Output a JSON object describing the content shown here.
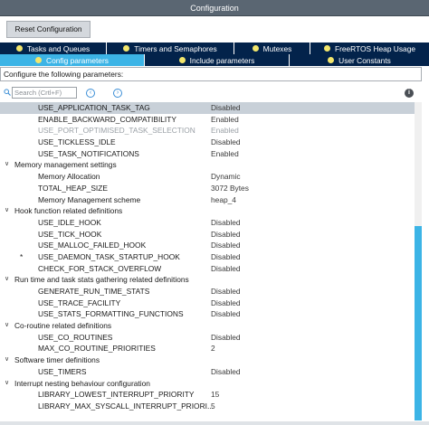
{
  "window": {
    "title": "Configuration"
  },
  "reset_button": "Reset Configuration",
  "tabs_row1": [
    {
      "label": "Tasks and Queues"
    },
    {
      "label": "Timers and Semaphores"
    },
    {
      "label": "Mutexes"
    },
    {
      "label": "FreeRTOS Heap Usage"
    }
  ],
  "tabs_row2": [
    {
      "label": "Config parameters",
      "active": true
    },
    {
      "label": "Include parameters"
    },
    {
      "label": "User Constants"
    }
  ],
  "configure_label": "Configure the following parameters:",
  "search": {
    "placeholder": "Search (Crtl+F)",
    "prev": "‹",
    "next": "›"
  },
  "info_icon": "i",
  "params": [
    {
      "name": "USE_APPLICATION_TASK_TAG",
      "value": "Disabled",
      "selected": true
    },
    {
      "name": "ENABLE_BACKWARD_COMPATIBILITY",
      "value": "Enabled"
    },
    {
      "name": "USE_PORT_OPTIMISED_TASK_SELECTION",
      "value": "Enabled",
      "disabled": true
    },
    {
      "name": "USE_TICKLESS_IDLE",
      "value": "Disabled"
    },
    {
      "name": "USE_TASK_NOTIFICATIONS",
      "value": "Enabled"
    }
  ],
  "groups": [
    {
      "title": "Memory management settings",
      "items": [
        {
          "name": "Memory Allocation",
          "value": "Dynamic"
        },
        {
          "name": "TOTAL_HEAP_SIZE",
          "value": "3072 Bytes"
        },
        {
          "name": "Memory Management scheme",
          "value": "heap_4"
        }
      ]
    },
    {
      "title": "Hook function related definitions",
      "items": [
        {
          "name": "USE_IDLE_HOOK",
          "value": "Disabled"
        },
        {
          "name": "USE_TICK_HOOK",
          "value": "Disabled"
        },
        {
          "name": "USE_MALLOC_FAILED_HOOK",
          "value": "Disabled"
        },
        {
          "name": "USE_DAEMON_TASK_STARTUP_HOOK",
          "value": "Disabled",
          "star": "*"
        },
        {
          "name": "CHECK_FOR_STACK_OVERFLOW",
          "value": "Disabled"
        }
      ]
    },
    {
      "title": "Run time and task stats gathering related definitions",
      "items": [
        {
          "name": "GENERATE_RUN_TIME_STATS",
          "value": "Disabled"
        },
        {
          "name": "USE_TRACE_FACILITY",
          "value": "Disabled"
        },
        {
          "name": "USE_STATS_FORMATTING_FUNCTIONS",
          "value": "Disabled"
        }
      ]
    },
    {
      "title": "Co-routine related definitions",
      "items": [
        {
          "name": "USE_CO_ROUTINES",
          "value": "Disabled"
        },
        {
          "name": "MAX_CO_ROUTINE_PRIORITIES",
          "value": "2"
        }
      ]
    },
    {
      "title": "Software timer definitions",
      "items": [
        {
          "name": "USE_TIMERS",
          "value": "Disabled"
        }
      ]
    },
    {
      "title": "Interrupt nesting behaviour configuration",
      "items": [
        {
          "name": "LIBRARY_LOWEST_INTERRUPT_PRIORITY",
          "value": "15"
        },
        {
          "name": "LIBRARY_MAX_SYSCALL_INTERRUPT_PRIORI...",
          "value": "5"
        }
      ]
    }
  ]
}
